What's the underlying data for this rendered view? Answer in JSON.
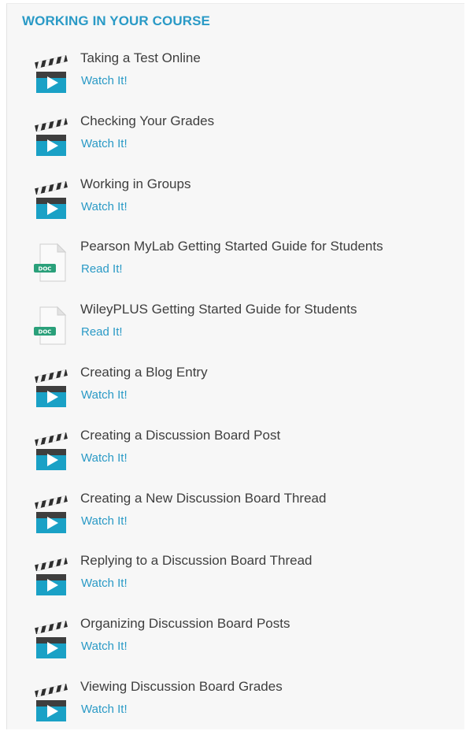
{
  "section": {
    "title": "WORKING IN YOUR COURSE"
  },
  "items": [
    {
      "title": "Taking a Test Online",
      "link": "Watch It!",
      "icon": "video-clapperboard-icon"
    },
    {
      "title": "Checking Your Grades",
      "link": "Watch It!",
      "icon": "video-clapperboard-icon"
    },
    {
      "title": "Working in Groups",
      "link": "Watch It!",
      "icon": "video-clapperboard-icon"
    },
    {
      "title": "Pearson MyLab Getting Started Guide for Students",
      "link": "Read It!",
      "icon": "document-icon",
      "icon_label": "DOC"
    },
    {
      "title": "WileyPLUS Getting Started Guide for Students",
      "link": "Read It!",
      "icon": "document-icon",
      "icon_label": "DOC"
    },
    {
      "title": "Creating a Blog Entry",
      "link": "Watch It!",
      "icon": "video-clapperboard-icon"
    },
    {
      "title": "Creating a Discussion Board Post",
      "link": "Watch It!",
      "icon": "video-clapperboard-icon"
    },
    {
      "title": "Creating a New Discussion Board Thread",
      "link": "Watch It!",
      "icon": "video-clapperboard-icon"
    },
    {
      "title": "Replying to a Discussion Board Thread",
      "link": "Watch It!",
      "icon": "video-clapperboard-icon"
    },
    {
      "title": "Organizing Discussion Board Posts",
      "link": "Watch It!",
      "icon": "video-clapperboard-icon"
    },
    {
      "title": "Viewing Discussion Board Grades",
      "link": "Watch It!",
      "icon": "video-clapperboard-icon"
    }
  ],
  "colors": {
    "accent": "#2a9ac6",
    "title_text": "#3e3e3e",
    "panel_bg": "#f7f7f7"
  }
}
